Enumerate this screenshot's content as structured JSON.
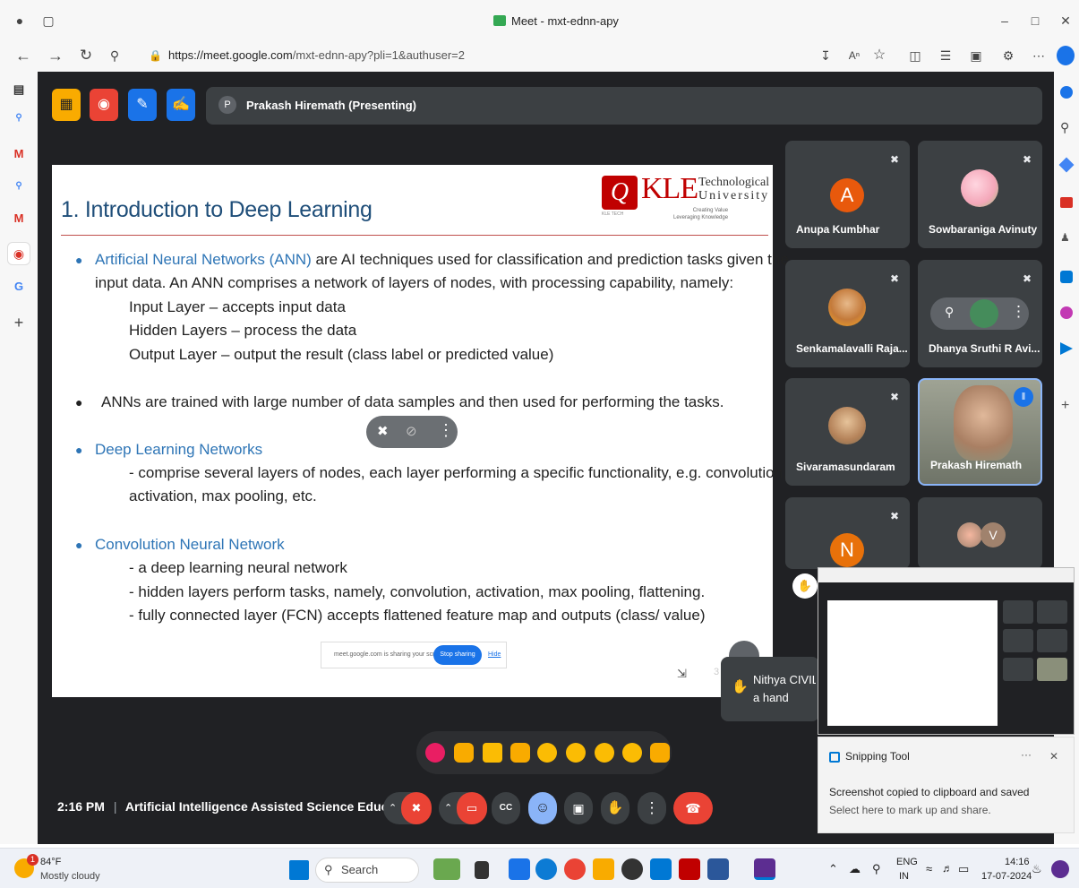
{
  "browser": {
    "tab_title": "Meet - mxt-ednn-apy",
    "url_host": "https://meet.google.com",
    "url_rest": "/mxt-ednn-apy?pli=1&authuser=2"
  },
  "meet": {
    "presenter_initial": "P",
    "presenting_label": "Prakash Hiremath (Presenting)",
    "meeting_time": "2:16 PM",
    "separator": "|",
    "meeting_title": "Artificial Intelligence Assisted Science Educati...",
    "hand_name": "Nithya CIVIL",
    "hand_text": "a hand",
    "tile_number": "3"
  },
  "slide": {
    "title": "1. Introduction to Deep Learning",
    "logo_mark": "Q",
    "logo_kle": "KLE",
    "logo_tech_line1": "Technological",
    "logo_tech_line2": "University",
    "logo_tag1": "Creating Value",
    "logo_tag2": "Leveraging Knowledge",
    "logo_small": "KLE TECH",
    "b1_term": "Artificial Neural Networks (ANN)",
    "b1_rest": " are AI techniques used for classification and prediction tasks given the",
    "b1_line2": "input data. An ANN comprises a network of layers of nodes, with processing capability, namely:",
    "b1_sub1": "Input Layer – accepts input data",
    "b1_sub2": "Hidden Layers – process the data",
    "b1_sub3": "Output Layer – output the result (class label or predicted value)",
    "b2": "ANNs are trained with large number of data samples and then used for performing the tasks.",
    "b3_term": "Deep Learning Networks",
    "b3_line1": "- comprise several layers of nodes, each layer performing a specific functionality, e.g. convolution,",
    "b3_line2": "activation, max pooling, etc.",
    "b4_term": "Convolution Neural Network",
    "b4_sub1": "- a deep learning neural network",
    "b4_sub2": "- hidden layers perform tasks, namely, convolution, activation, max pooling, flattening.",
    "b4_sub3": "- fully connected layer (FCN) accepts flattened feature map and outputs (class/ value)",
    "share_text": "meet.google.com is sharing your screen.",
    "stop_sharing": "Stop sharing",
    "hide": "Hide"
  },
  "participants": [
    {
      "name": "Anupa Kumbhar",
      "initial": "A",
      "color": "#e8590c"
    },
    {
      "name": "Sowbaraniga Avinuty",
      "initial": "",
      "color": "#f4a7b9"
    },
    {
      "name": "Senkamalavalli Raja...",
      "initial": "",
      "color": "#c47a3a"
    },
    {
      "name": "Dhanya Sruthi R Avi...",
      "initial": "",
      "color": "#5f6368"
    },
    {
      "name": "Sivaramasundaram",
      "initial": "",
      "color": "#b5835a"
    },
    {
      "name": "Prakash Hiremath",
      "initial": "",
      "color": "#8a8f7a"
    },
    {
      "name": "",
      "initial": "N",
      "color": "#e8710a"
    },
    {
      "name": "",
      "initial": "V",
      "color": "#a0826d"
    }
  ],
  "snipping": {
    "app_name": "Snipping Tool",
    "more": "···",
    "close": "✕",
    "message": "Screenshot copied to clipboard and saved",
    "sub": "Select here to mark up and share."
  },
  "taskbar": {
    "weather_temp": "84°F",
    "weather_desc": "Mostly cloudy",
    "weather_badge": "1",
    "search": "Search",
    "lang1": "ENG",
    "lang2": "IN",
    "time": "14:16",
    "date": "17-07-2024"
  },
  "colors": {
    "meet_bg": "#202124",
    "tile_bg": "#3c4043",
    "end_call": "#ea4335",
    "accent_blue": "#1a73e8",
    "slide_title": "#1f4e79"
  }
}
